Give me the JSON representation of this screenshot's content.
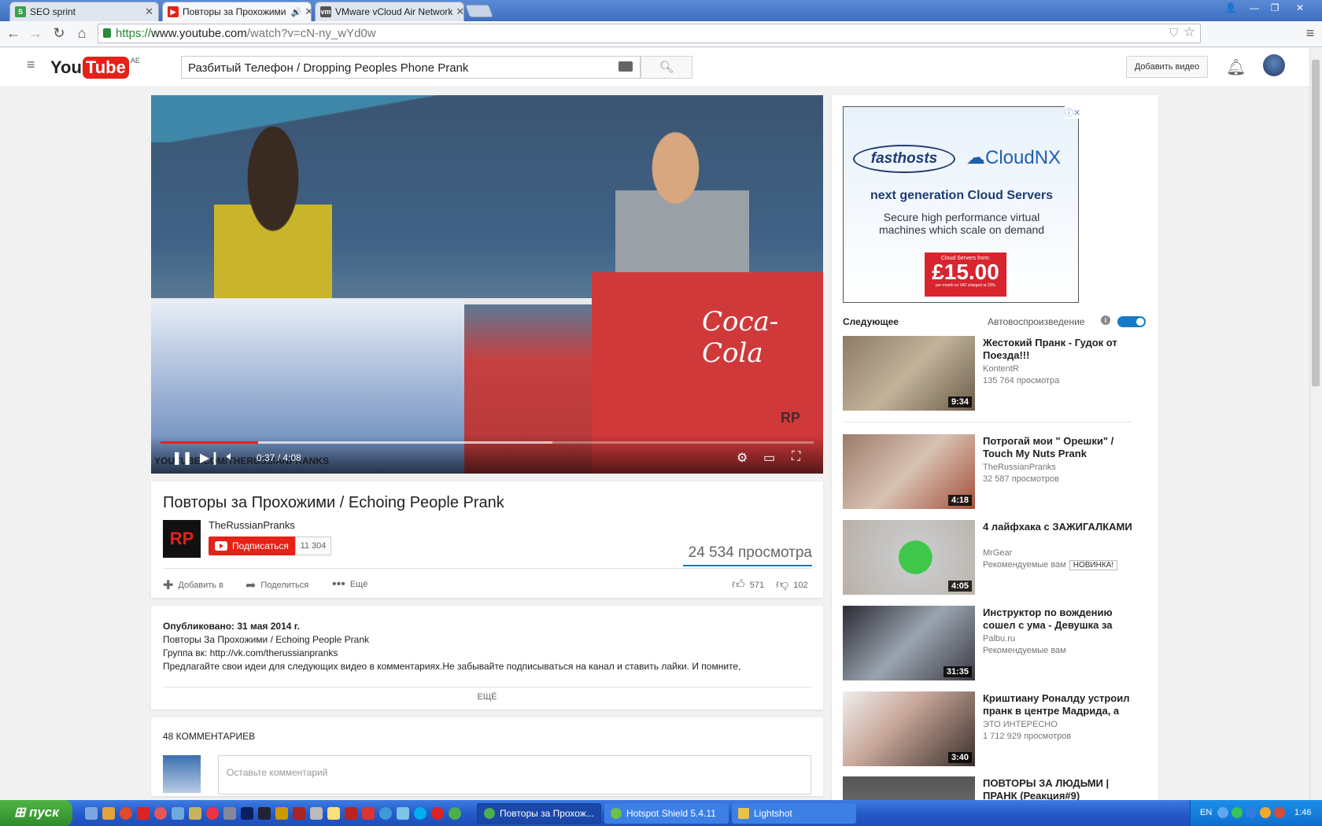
{
  "browser": {
    "tabs": [
      {
        "title": "SEO sprint",
        "active": false
      },
      {
        "title": "Повторы за Прохожими",
        "active": true
      },
      {
        "title": "VMware vCloud Air Network",
        "active": false
      }
    ],
    "url": {
      "scheme": "https://",
      "host": "www.youtube.com",
      "path": "/watch?v=cN-ny_wYd0w"
    }
  },
  "header": {
    "logo_you": "You",
    "logo_tube": "Tube",
    "country": "AE",
    "search_value": "Разбитый Телефон / Dropping Peoples Phone Prank",
    "upload_label": "Добавить видео"
  },
  "player": {
    "time": "0:37 / 4:08",
    "progress": 0.149,
    "buffered": 0.6,
    "overlay_brand": "Coca-Cola",
    "overlay_wm": "RP",
    "watermark": "YOUTUBE.COM/THERUSSIANPRANKS"
  },
  "video": {
    "title": "Повторы за Прохожими / Echoing People Prank",
    "channel_avatar": "RP",
    "channel": "TheRussianPranks",
    "subscribe_label": "Подписаться",
    "subscriber_count": "11 304",
    "views": "24 534 просмотра",
    "actions": {
      "add": "Добавить в",
      "share": "Поделиться",
      "more": "Ещё"
    },
    "likes": "571",
    "dislikes": "102"
  },
  "description": {
    "published": "Опубликовано: 31 мая 2014 г.",
    "lines": [
      "Повторы За Прохожими / Echoing People Prank",
      "Группа вк: http://vk.com/therussianpranks",
      "Предлагайте свои идеи для следующих видео в комментариях.Не забывайте подписываться на канал и ставить лайки. И помните,"
    ],
    "more_label": "ЕЩЁ"
  },
  "comments": {
    "count_label": "48 КОММЕНТАРИЕВ",
    "placeholder": "Оставьте комментарий"
  },
  "ad": {
    "brand1": "fasthosts",
    "brand2": "CloudNX",
    "headline": "next generation Cloud Servers",
    "sub": "Secure high performance virtual machines which scale on demand",
    "price_label": "Cloud Servers from:",
    "price": "£15.00",
    "price_note": "per month ex VAT charged at 20%"
  },
  "sidebar": {
    "next_label": "Следующее",
    "autoplay_label": "Автовоспроизведение",
    "autoplay_on": true,
    "videos": [
      {
        "title": "Жестокий Пранк - Гудок от Поезда!!!",
        "channel": "KontentR",
        "meta": "135 764 просмотра",
        "duration": "9:34",
        "badge": ""
      },
      {
        "title": "Потрогай мои \" Орешки\" / Touch My Nuts Prank",
        "channel": "TheRussianPranks",
        "meta": "32 587 просмотров",
        "duration": "4:18",
        "badge": ""
      },
      {
        "title": "4 лайфхака с ЗАЖИГАЛКАМИ",
        "channel": "MrGear",
        "meta": "Рекомендуемые вам",
        "duration": "4:05",
        "badge": "НОВИНКА!"
      },
      {
        "title": "Инструктор по вождению сошел с ума - Девушка за рулем",
        "channel": "Palbu.ru",
        "meta": "Рекомендуемые вам",
        "duration": "31:35",
        "badge": ""
      },
      {
        "title": "Криштиану Роналду устроил пранк в центре Мадрида, а",
        "channel": "ЭТО ИНТЕРЕСНО",
        "meta": "1 712 929 просмотров",
        "duration": "3:40",
        "badge": ""
      },
      {
        "title": "ПОВТОРЫ ЗА ЛЮДЬМИ | ПРАНК (Реакция#9)",
        "channel": "",
        "meta": "",
        "duration": "",
        "badge": ""
      }
    ]
  },
  "taskbar": {
    "start_label": "пуск",
    "tasks": [
      "Повторы за Прохож...",
      "Hotspot Shield 5.4.11",
      "Lightshot"
    ],
    "lang": "EN",
    "clock": "1:46"
  },
  "colors": {
    "youtube_red": "#e62117",
    "link_blue": "#167ac6",
    "xp_blue": "#2459c8"
  }
}
